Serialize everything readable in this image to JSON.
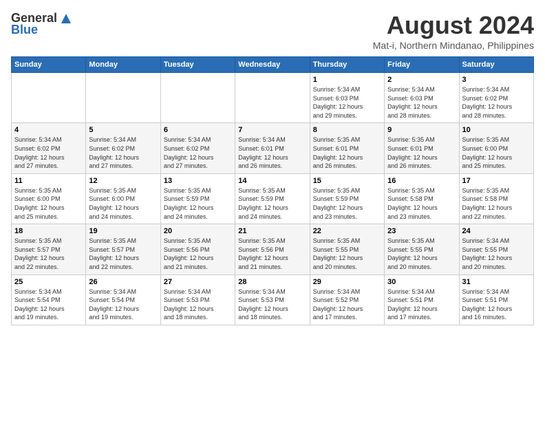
{
  "header": {
    "logo_general": "General",
    "logo_blue": "Blue",
    "month_title": "August 2024",
    "location": "Mat-i, Northern Mindanao, Philippines"
  },
  "weekdays": [
    "Sunday",
    "Monday",
    "Tuesday",
    "Wednesday",
    "Thursday",
    "Friday",
    "Saturday"
  ],
  "weeks": [
    [
      {
        "day": "",
        "info": ""
      },
      {
        "day": "",
        "info": ""
      },
      {
        "day": "",
        "info": ""
      },
      {
        "day": "",
        "info": ""
      },
      {
        "day": "1",
        "info": "Sunrise: 5:34 AM\nSunset: 6:03 PM\nDaylight: 12 hours\nand 29 minutes."
      },
      {
        "day": "2",
        "info": "Sunrise: 5:34 AM\nSunset: 6:03 PM\nDaylight: 12 hours\nand 28 minutes."
      },
      {
        "day": "3",
        "info": "Sunrise: 5:34 AM\nSunset: 6:02 PM\nDaylight: 12 hours\nand 28 minutes."
      }
    ],
    [
      {
        "day": "4",
        "info": "Sunrise: 5:34 AM\nSunset: 6:02 PM\nDaylight: 12 hours\nand 27 minutes."
      },
      {
        "day": "5",
        "info": "Sunrise: 5:34 AM\nSunset: 6:02 PM\nDaylight: 12 hours\nand 27 minutes."
      },
      {
        "day": "6",
        "info": "Sunrise: 5:34 AM\nSunset: 6:02 PM\nDaylight: 12 hours\nand 27 minutes."
      },
      {
        "day": "7",
        "info": "Sunrise: 5:34 AM\nSunset: 6:01 PM\nDaylight: 12 hours\nand 26 minutes."
      },
      {
        "day": "8",
        "info": "Sunrise: 5:35 AM\nSunset: 6:01 PM\nDaylight: 12 hours\nand 26 minutes."
      },
      {
        "day": "9",
        "info": "Sunrise: 5:35 AM\nSunset: 6:01 PM\nDaylight: 12 hours\nand 26 minutes."
      },
      {
        "day": "10",
        "info": "Sunrise: 5:35 AM\nSunset: 6:00 PM\nDaylight: 12 hours\nand 25 minutes."
      }
    ],
    [
      {
        "day": "11",
        "info": "Sunrise: 5:35 AM\nSunset: 6:00 PM\nDaylight: 12 hours\nand 25 minutes."
      },
      {
        "day": "12",
        "info": "Sunrise: 5:35 AM\nSunset: 6:00 PM\nDaylight: 12 hours\nand 24 minutes."
      },
      {
        "day": "13",
        "info": "Sunrise: 5:35 AM\nSunset: 5:59 PM\nDaylight: 12 hours\nand 24 minutes."
      },
      {
        "day": "14",
        "info": "Sunrise: 5:35 AM\nSunset: 5:59 PM\nDaylight: 12 hours\nand 24 minutes."
      },
      {
        "day": "15",
        "info": "Sunrise: 5:35 AM\nSunset: 5:59 PM\nDaylight: 12 hours\nand 23 minutes."
      },
      {
        "day": "16",
        "info": "Sunrise: 5:35 AM\nSunset: 5:58 PM\nDaylight: 12 hours\nand 23 minutes."
      },
      {
        "day": "17",
        "info": "Sunrise: 5:35 AM\nSunset: 5:58 PM\nDaylight: 12 hours\nand 22 minutes."
      }
    ],
    [
      {
        "day": "18",
        "info": "Sunrise: 5:35 AM\nSunset: 5:57 PM\nDaylight: 12 hours\nand 22 minutes."
      },
      {
        "day": "19",
        "info": "Sunrise: 5:35 AM\nSunset: 5:57 PM\nDaylight: 12 hours\nand 22 minutes."
      },
      {
        "day": "20",
        "info": "Sunrise: 5:35 AM\nSunset: 5:56 PM\nDaylight: 12 hours\nand 21 minutes."
      },
      {
        "day": "21",
        "info": "Sunrise: 5:35 AM\nSunset: 5:56 PM\nDaylight: 12 hours\nand 21 minutes."
      },
      {
        "day": "22",
        "info": "Sunrise: 5:35 AM\nSunset: 5:55 PM\nDaylight: 12 hours\nand 20 minutes."
      },
      {
        "day": "23",
        "info": "Sunrise: 5:35 AM\nSunset: 5:55 PM\nDaylight: 12 hours\nand 20 minutes."
      },
      {
        "day": "24",
        "info": "Sunrise: 5:34 AM\nSunset: 5:55 PM\nDaylight: 12 hours\nand 20 minutes."
      }
    ],
    [
      {
        "day": "25",
        "info": "Sunrise: 5:34 AM\nSunset: 5:54 PM\nDaylight: 12 hours\nand 19 minutes."
      },
      {
        "day": "26",
        "info": "Sunrise: 5:34 AM\nSunset: 5:54 PM\nDaylight: 12 hours\nand 19 minutes."
      },
      {
        "day": "27",
        "info": "Sunrise: 5:34 AM\nSunset: 5:53 PM\nDaylight: 12 hours\nand 18 minutes."
      },
      {
        "day": "28",
        "info": "Sunrise: 5:34 AM\nSunset: 5:53 PM\nDaylight: 12 hours\nand 18 minutes."
      },
      {
        "day": "29",
        "info": "Sunrise: 5:34 AM\nSunset: 5:52 PM\nDaylight: 12 hours\nand 17 minutes."
      },
      {
        "day": "30",
        "info": "Sunrise: 5:34 AM\nSunset: 5:51 PM\nDaylight: 12 hours\nand 17 minutes."
      },
      {
        "day": "31",
        "info": "Sunrise: 5:34 AM\nSunset: 5:51 PM\nDaylight: 12 hours\nand 16 minutes."
      }
    ]
  ]
}
